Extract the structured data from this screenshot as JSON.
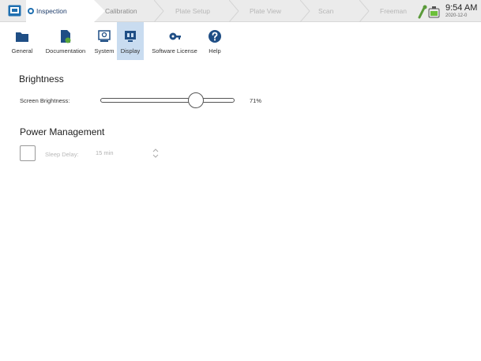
{
  "workflow": {
    "steps": [
      "Inspection",
      "Calibration",
      "Plate Setup",
      "Plate View",
      "Scan",
      "Freeman"
    ]
  },
  "status": {
    "time": "9:54 AM",
    "date": "2020-12-0"
  },
  "categories": [
    {
      "label": "General",
      "icon": "folder-icon"
    },
    {
      "label": "Documentation",
      "icon": "document-icon"
    },
    {
      "label": "System",
      "icon": "system-icon"
    },
    {
      "label": "Display",
      "icon": "display-icon"
    },
    {
      "label": "Software License",
      "icon": "key-icon"
    },
    {
      "label": "Help",
      "icon": "help-icon"
    }
  ],
  "selected_category": "Display",
  "brightness": {
    "title": "Brightness",
    "label": "Screen Brightness:",
    "value_text": "71%",
    "value": 71
  },
  "power": {
    "title": "Power Management",
    "sleep_label": "Sleep Delay:",
    "sleep_value": "15 min",
    "sleep_enabled": false
  },
  "colors": {
    "accent": "#1f6fb0",
    "selected_bg": "#c9dcf0",
    "tab_bg": "#ebebeb"
  }
}
